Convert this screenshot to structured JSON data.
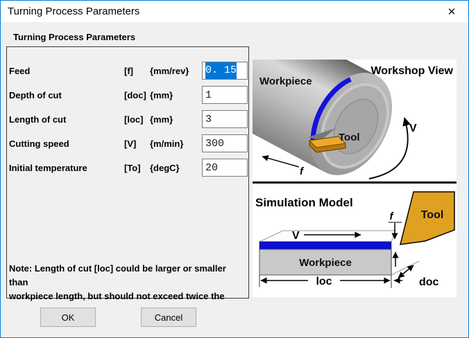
{
  "window": {
    "title": "Turning Process Parameters",
    "close_glyph": "✕"
  },
  "group": {
    "label": "Turning Process Parameters"
  },
  "form": {
    "rows": [
      {
        "label": "Feed",
        "symbol": "[f]",
        "unit": "{mm/rev}",
        "value": "0. 15"
      },
      {
        "label": "Depth of cut",
        "symbol": "[doc]",
        "unit": "{mm}",
        "value": "1"
      },
      {
        "label": "Length of cut",
        "symbol": "[loc]",
        "unit": "{mm}",
        "value": "3"
      },
      {
        "label": "Cutting speed",
        "symbol": "[V]",
        "unit": "{m/min}",
        "value": "300"
      },
      {
        "label": "Initial temperature",
        "symbol": "[To]",
        "unit": "{degC}",
        "value": "20"
      }
    ],
    "note_line1": "Note: Length of cut [loc] could be larger or smaller than",
    "note_line2": "workpiece length, but should not exceed twice the"
  },
  "buttons": {
    "ok": "OK",
    "cancel": "Cancel"
  },
  "workshop": {
    "title": "Workshop View",
    "workpiece_label": "Workpiece",
    "tool_label": "Tool",
    "speed_label": "V",
    "feed_label": "f"
  },
  "simulation": {
    "title": "Simulation Model",
    "workpiece_label": "Workpiece",
    "tool_label": "Tool",
    "speed_label": "V",
    "feed_label": "f",
    "length_label": "loc",
    "depth_label": "doc"
  },
  "colors": {
    "window_border": "#0078d7",
    "selection_blue": "#0078d7",
    "tool_orange": "#dfa11f",
    "cut_blue": "#1313dc",
    "dialog_bg": "#f0f0f0"
  }
}
